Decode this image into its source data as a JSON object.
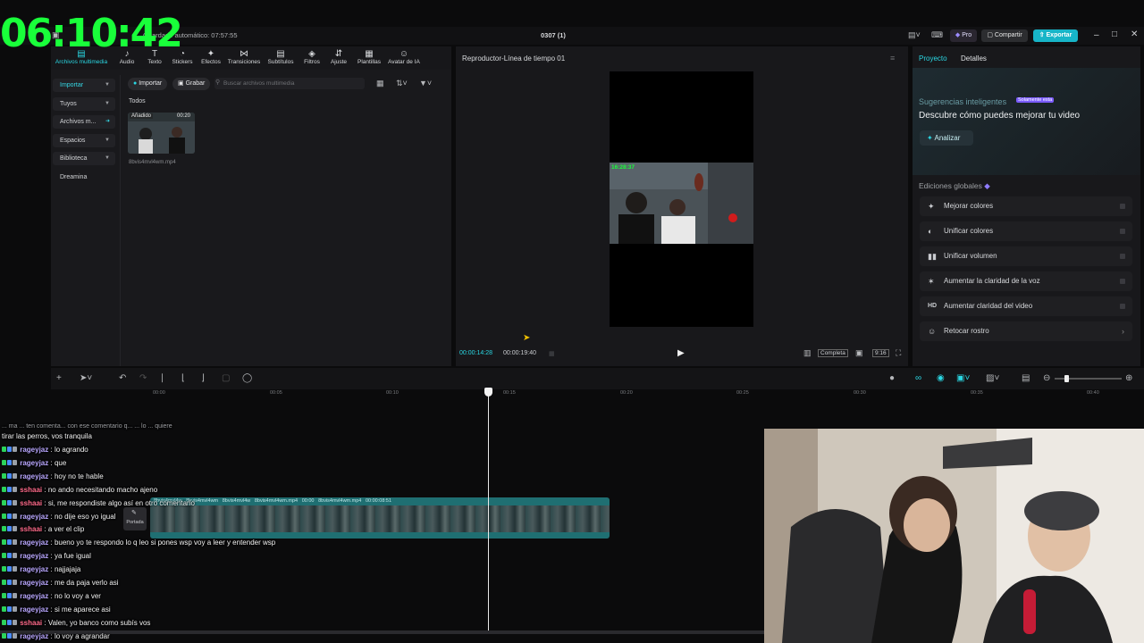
{
  "overlay": {
    "timer": "06:10:42"
  },
  "titlebar": {
    "autosave": "Guardado automático: 07:57:55",
    "project_name": "0307 (1)",
    "pro_label": "Pro",
    "share_label": "Compartir",
    "export_label": "Exportar"
  },
  "toolbar": {
    "items": [
      {
        "label": "Archivos multimedia",
        "icon": "media-icon"
      },
      {
        "label": "Audio",
        "icon": "audio-icon"
      },
      {
        "label": "Texto",
        "icon": "text-icon"
      },
      {
        "label": "Stickers",
        "icon": "sticker-icon"
      },
      {
        "label": "Efectos",
        "icon": "effects-icon"
      },
      {
        "label": "Transiciones",
        "icon": "transitions-icon"
      },
      {
        "label": "Subtítulos",
        "icon": "subtitles-icon"
      },
      {
        "label": "Filtros",
        "icon": "filters-icon"
      },
      {
        "label": "Ajuste",
        "icon": "adjust-icon"
      },
      {
        "label": "Plantillas",
        "icon": "templates-icon"
      },
      {
        "label": "Avatar de IA",
        "icon": "ai-avatar-icon"
      }
    ]
  },
  "media": {
    "nav": [
      "Importar",
      "Tuyos",
      "Archivos m...",
      "Espacios",
      "Biblioteca",
      "Dreamina"
    ],
    "import_label": "Importar",
    "record_label": "Grabar",
    "search_placeholder": "Buscar archivos multimedia",
    "section_all": "Todos",
    "clip": {
      "added_badge": "Añadido",
      "duration": "00:20",
      "filename": "8bvis4mvl4wm.mp4"
    }
  },
  "player": {
    "title": "Reproductor-Línea de tiempo 01",
    "current_time": "00:00:14:28",
    "total_time": "00:00:19:40",
    "overlay_time": "16:28:37",
    "mode_label": "Completa",
    "ratio_label": "9:16"
  },
  "rightpanel": {
    "tabs": [
      "Proyecto",
      "Detalles"
    ],
    "smart_title": "Sugerencias inteligentes",
    "smart_badge": "Solamente esta",
    "smart_heading": "Descubre cómo puedes mejorar tu video",
    "analyze_label": "Analizar",
    "global_title": "Ediciones globales",
    "global_items": [
      {
        "label": "Mejorar colores",
        "icon": "wand-icon"
      },
      {
        "label": "Unificar colores",
        "icon": "palette-icon"
      },
      {
        "label": "Unificar volumen",
        "icon": "volume-bars-icon"
      },
      {
        "label": "Aumentar la claridad de la voz",
        "icon": "voice-icon"
      },
      {
        "label": "Aumentar claridad del video",
        "icon": "hd-icon"
      },
      {
        "label": "Retocar rostro",
        "icon": "face-icon"
      }
    ]
  },
  "timeline": {
    "ticks": [
      "00:00",
      "00:05",
      "00:10",
      "00:15",
      "00:20",
      "00:25",
      "00:30",
      "00:35",
      "00:40"
    ],
    "cover_label": "Portada",
    "clip_labels": [
      "8bvis4mvl4w",
      "8bvis4mvl4wm",
      "8bvis4mvl4w",
      "8bvis4mvl4wm.mp4",
      "00:00",
      "8bvis4mvl4wm.mp4",
      "00:00:08:51"
    ],
    "playhead_fraction": 0.36
  },
  "chat": {
    "partial_line": "... ma ... ten comenta... con ese comentario q... ... lo ... quiere",
    "continuation": "tirar las perros, vos tranquila",
    "messages": [
      {
        "user": "rageyjaz",
        "text": ": lo agrando"
      },
      {
        "user": "rageyjaz",
        "text": ": que"
      },
      {
        "user": "rageyjaz",
        "text": ": hoy no te hable"
      },
      {
        "user": "sshaai",
        "text": ": no ando necesitando macho ajeno"
      },
      {
        "user": "sshaai",
        "text": ": si, me respondiste algo así en otro comentario"
      },
      {
        "user": "rageyjaz",
        "text": ": no dije eso yo igual"
      },
      {
        "user": "sshaai",
        "text": ": a ver el clip"
      },
      {
        "user": "rageyjaz",
        "text": ": bueno yo te respondo lo q leo si pones wsp voy a leer y entender wsp"
      },
      {
        "user": "rageyjaz",
        "text": ": ya fue igual"
      },
      {
        "user": "rageyjaz",
        "text": ": najjajaja"
      },
      {
        "user": "rageyjaz",
        "text": ": me da paja verlo asi"
      },
      {
        "user": "rageyjaz",
        "text": ": no lo voy a ver"
      },
      {
        "user": "rageyjaz",
        "text": ": si me aparece asi"
      },
      {
        "user": "sshaai",
        "text": ": Valen, yo banco como subís vos"
      },
      {
        "user": "rageyjaz",
        "text": ": lo voy a agrandar"
      }
    ],
    "colors": {
      "rageyjaz": "#b9a7ff",
      "sshaai": "#ff6b8b"
    }
  },
  "colors": {
    "accent": "#17b5c8",
    "timer": "#19ff3a",
    "playhead_time": "#2ad7e3"
  }
}
